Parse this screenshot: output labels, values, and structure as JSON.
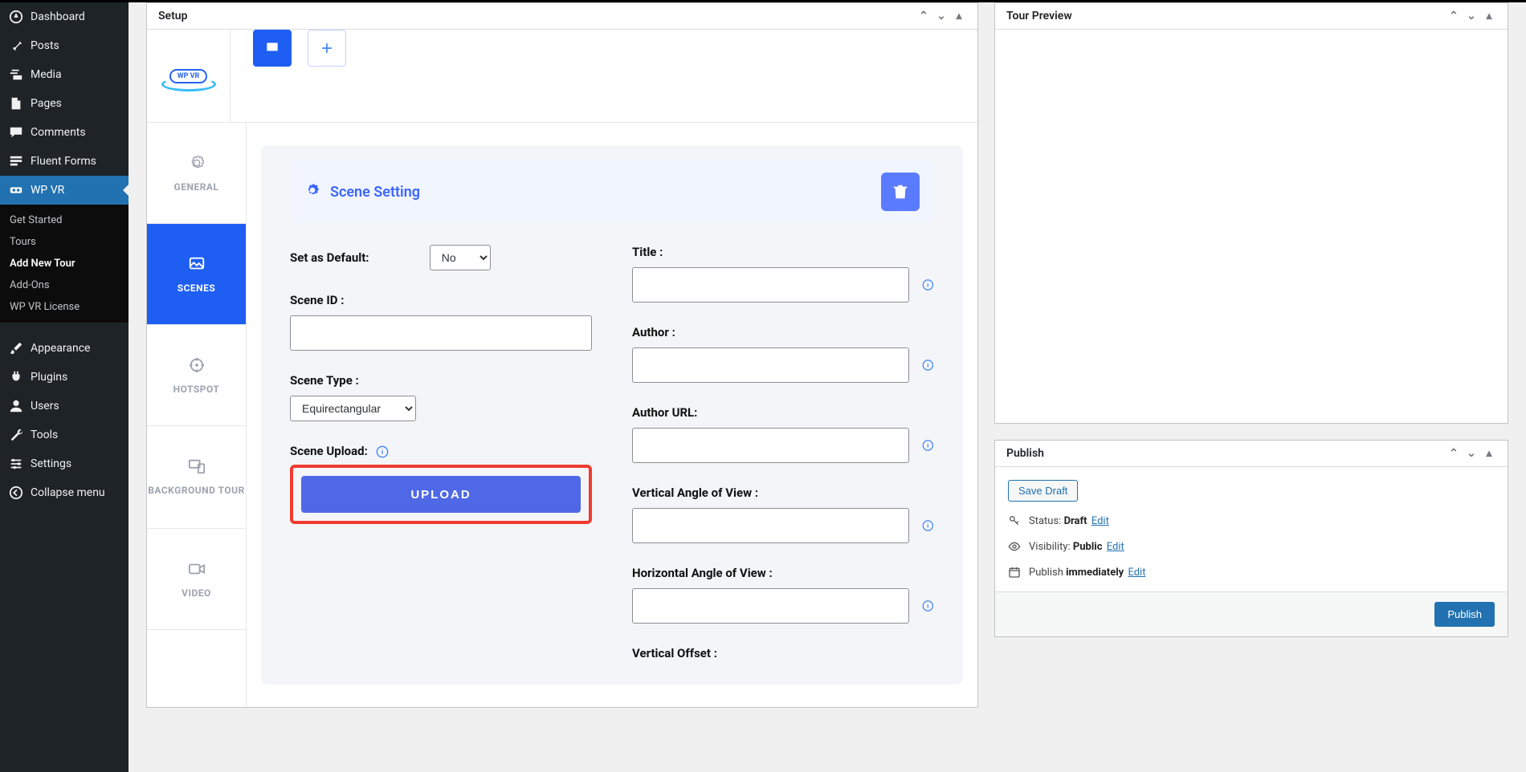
{
  "sidebar": {
    "main": [
      {
        "label": "Dashboard"
      },
      {
        "label": "Posts"
      },
      {
        "label": "Media"
      },
      {
        "label": "Pages"
      },
      {
        "label": "Comments"
      },
      {
        "label": "Fluent Forms"
      },
      {
        "label": "WP VR",
        "active": true
      },
      {
        "label": "Appearance"
      },
      {
        "label": "Plugins"
      },
      {
        "label": "Users"
      },
      {
        "label": "Tools"
      },
      {
        "label": "Settings"
      },
      {
        "label": "Collapse menu"
      }
    ],
    "wpvr_sub": [
      {
        "label": "Get Started"
      },
      {
        "label": "Tours"
      },
      {
        "label": "Add New Tour",
        "bold": true
      },
      {
        "label": "Add-Ons"
      },
      {
        "label": "WP VR License"
      }
    ]
  },
  "setup": {
    "title": "Setup",
    "logo": "WP VR",
    "strip": [
      {
        "label": "GENERAL"
      },
      {
        "label": "SCENES",
        "active": true
      },
      {
        "label": "HOTSPOT"
      },
      {
        "label": "BACKGROUND TOUR",
        "line2": ""
      },
      {
        "label": "VIDEO"
      }
    ],
    "section_title": "Scene Setting"
  },
  "fields": {
    "default_label": "Set as Default:",
    "default_value": "No",
    "scene_id_label": "Scene ID :",
    "scene_type_label": "Scene Type :",
    "scene_type_value": "Equirectangular",
    "upload_label": "Scene Upload:",
    "upload_btn": "UPLOAD",
    "title_label": "Title :",
    "author_label": "Author :",
    "author_url_label": "Author URL:",
    "vangle_label": "Vertical Angle of View :",
    "hangle_label": "Horizontal Angle of View :",
    "voffset_label": "Vertical Offset :"
  },
  "preview": {
    "title": "Tour Preview"
  },
  "publish": {
    "title": "Publish",
    "save_draft": "Save Draft",
    "status_label": "Status:",
    "status_value": "Draft",
    "visibility_label": "Visibility:",
    "visibility_value": "Public",
    "publish_label": "Publish",
    "publish_value": "immediately",
    "edit": "Edit",
    "publish_btn": "Publish"
  }
}
